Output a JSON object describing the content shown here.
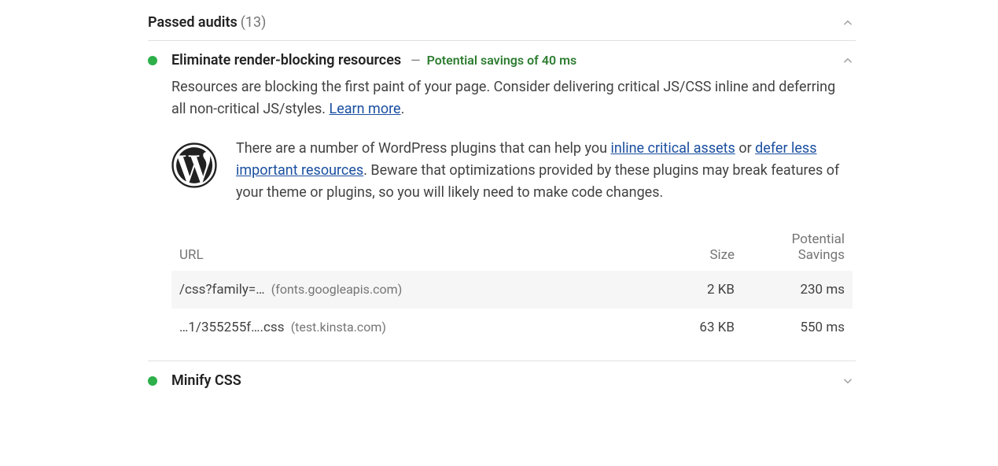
{
  "passed_audits": {
    "label": "Passed audits",
    "count": "(13)"
  },
  "audit_eliminate": {
    "title": "Eliminate render-blocking resources",
    "savings_sep": "—",
    "savings": "Potential savings of 40 ms",
    "description_part1": "Resources are blocking the first paint of your page. Consider delivering critical JS/CSS inline and deferring all non-critical JS/styles. ",
    "learn_more": "Learn more",
    "description_part2": ".",
    "stack_part1": "There are a number of WordPress plugins that can help you ",
    "stack_link1": "inline critical assets",
    "stack_part2": " or ",
    "stack_link2": "defer less important resources",
    "stack_part3": ". Beware that optimizations provided by these plugins may break features of your theme or plugins, so you will likely need to make code changes.",
    "table": {
      "headers": {
        "url": "URL",
        "size": "Size",
        "savings": "Potential Savings"
      },
      "rows": [
        {
          "path": "/css?family=…",
          "host": "(fonts.googleapis.com)",
          "size": "2 KB",
          "savings": "230 ms"
        },
        {
          "path": "…1/355255f….css",
          "host": "(test.kinsta.com)",
          "size": "63 KB",
          "savings": "550 ms"
        }
      ]
    }
  },
  "audit_minify": {
    "title": "Minify CSS"
  }
}
